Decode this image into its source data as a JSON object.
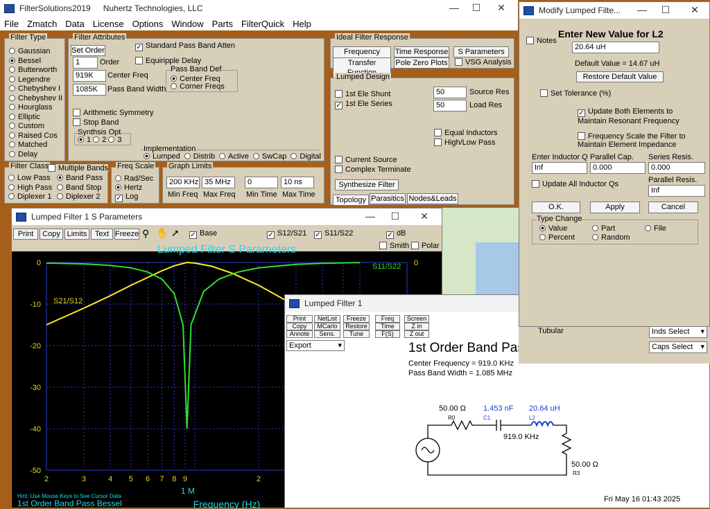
{
  "main": {
    "title": "FilterSolutions2019",
    "company": "Nuhertz Technologies, LLC",
    "menu": [
      "File",
      "Zmatch",
      "Data",
      "License",
      "Options",
      "Window",
      "Parts",
      "FilterQuick",
      "Help"
    ],
    "filter_type": {
      "label": "Filter Type",
      "items": [
        "Gaussian",
        "Bessel",
        "Butterworth",
        "Legendre",
        "Chebyshev I",
        "Chebyshev II",
        "Hourglass",
        "Elliptic",
        "Custom",
        "Raised Cos",
        "Matched",
        "Delay"
      ],
      "selected": "Bessel"
    },
    "attributes": {
      "label": "Filter Attributes",
      "set_order": "Set Order",
      "order": "1",
      "order_label": "Order",
      "center_freq": "919K",
      "center_label": "Center Freq",
      "bw": "1085K",
      "bw_label": "Pass Band Width",
      "std_atten": "Standard Pass Band Atten",
      "equiripple": "Equiripple Delay",
      "pbdef": "Pass Band  Def",
      "center_freqs": "Center Freq",
      "corner_freqs": "Corner Freqs",
      "arith": "Arithmetic Symmetry",
      "stopband": "Stop Band",
      "synth": "Synthsis Opt",
      "s1": "1",
      "s2": "2",
      "s3": "3",
      "impl": "Implementation",
      "impl_items": [
        "Lumped",
        "Distrib",
        "Active",
        "SwCap",
        "Digital"
      ]
    },
    "ideal": {
      "label": "Ideal Filter Response",
      "b1": "Frequency Resp.",
      "b2": "Time Response",
      "b3": "S Parameters",
      "b4": "Transfer Function",
      "b5": "Pole Zero Plots",
      "b6": "VSG Analysis"
    },
    "lumped": {
      "label": "Lumped Design",
      "shunt": "1st Ele Shunt",
      "series": "1st Ele Series",
      "src": "50",
      "src_label": "Source Res",
      "load": "50",
      "load_label": "Load Res",
      "equal": "Equal Inductors",
      "hilo": "High/Low Pass",
      "current": "Current Source",
      "complex": "Complex Terminate",
      "synth": "Synthesize Filter",
      "tabs": [
        "Topology",
        "Parasitics",
        "Nodes&Leads"
      ]
    },
    "fclass": {
      "label": "Filter Class",
      "multi": "Multiple Bands",
      "items": [
        "Low Pass",
        "Band Pass",
        "High Pass",
        "Band Stop",
        "Diplexer 1",
        "Diplexer 2"
      ]
    },
    "fscale": {
      "label": "Freq Scale",
      "items": [
        "Rad/Sec",
        "Hertz"
      ],
      "log": "Log"
    },
    "glimits": {
      "label": "Graph Limits",
      "v": [
        "200 KHz",
        "35 MHz",
        "0",
        "10 ns"
      ],
      "l": [
        "Min Freq",
        "Max Freq",
        "Min Time",
        "Max Time"
      ]
    }
  },
  "sp": {
    "title": "Lumped Filter 1 S Parameters",
    "toolbar": [
      "Print",
      "Copy",
      "Limits",
      "Text",
      "Freeze"
    ],
    "base": "Base",
    "s12": "S12/S21",
    "s11": "S11/S22",
    "db": "dB",
    "smith": "Smith",
    "polar": "Polar",
    "heading": "Lumped Filter S Parameters",
    "xlabel": "Frequency (Hz)",
    "hint": "Hint: Use Mouse Keys to See Cursor Data",
    "footer": "1st Order Band Pass Bessel",
    "lbl_s21": "S21/S12",
    "lbl_s11": "S11/S22",
    "m": "1 M",
    "right0": "0"
  },
  "chart_data": {
    "type": "line",
    "title": "Lumped Filter S Parameters",
    "xlabel": "Frequency (Hz)",
    "ylabel": "",
    "xscale": "log",
    "xlim": [
      200000,
      10000000
    ],
    "ylim": [
      -50,
      0
    ],
    "yticks": [
      "0",
      "-10",
      "-20",
      "-30",
      "-40",
      "-50"
    ],
    "xticks": [
      "2",
      "3",
      "4",
      "5",
      "6",
      "7",
      "8",
      "9",
      "1 M",
      "2",
      "3",
      "4",
      "5",
      "6"
    ],
    "series": [
      {
        "name": "S21/S12",
        "color": "#ffee22",
        "x": [
          200000,
          300000,
          400000,
          500000,
          600000,
          700000,
          800000,
          919000,
          1000000,
          1200000,
          1500000,
          2000000,
          3000000,
          4000000,
          5000000,
          6000000
        ],
        "y": [
          -15,
          -11,
          -8,
          -5.5,
          -3.6,
          -2,
          -0.8,
          0,
          -0.15,
          -0.9,
          -2.6,
          -5.5,
          -10.5,
          -14,
          -17,
          -19
        ]
      },
      {
        "name": "S11/S22",
        "color": "#30e030",
        "x": [
          200000,
          300000,
          400000,
          500000,
          600000,
          700000,
          800000,
          880000,
          919000,
          960000,
          1100000,
          1300000,
          1600000,
          2000000,
          3000000,
          4000000,
          5000000,
          6000000
        ],
        "y": [
          -0.14,
          -0.35,
          -0.7,
          -1.3,
          -2.3,
          -4,
          -7.5,
          -15,
          -40,
          -15,
          -7,
          -4,
          -2.3,
          -1.3,
          -0.45,
          -0.2,
          -0.1,
          -0.05
        ]
      }
    ]
  },
  "sch": {
    "title": "Lumped Filter 1",
    "btns": [
      [
        "Print",
        "NetList",
        "Freeze",
        "Freq",
        "Screen"
      ],
      [
        "Copy",
        "MCarlo",
        "Restore",
        "Time",
        "Z in"
      ],
      [
        "Annote",
        "Sens.",
        "Tune",
        "F(S)",
        "Z out"
      ]
    ],
    "export": "Export",
    "heading": "1st Order Band Pass Bessel",
    "cf": "Center Frequency = 919.0 KHz",
    "pbw": "Pass Band Width = 1.085 MHz",
    "r0": "50.00 Ω",
    "r0n": "R0",
    "c1": "1.453 nF",
    "c1n": "C1",
    "l2": "20.64 uH",
    "l2n": "L2",
    "f": "919.0 KHz",
    "r3": "50.00 Ω",
    "r3n": "R3",
    "date": "Fri May 16 01:43 2025"
  },
  "mod": {
    "title": "Modify Lumped Filte...",
    "notes": "Notes",
    "heading": "Enter New Value for L2",
    "value": "20.64 uH",
    "default": "Default Value = 14.67 uH",
    "restore": "Restore Default Value",
    "tol": "Set Tolerance (%)",
    "upd1": "Update Both Elements to",
    "upd2": "Maintain Resonant Frequency",
    "fs1": "Frequency Scale the Filter to",
    "fs2": "Maintain Element Impedance",
    "iq": "Enter Inductor Q",
    "pc": "Parallel Cap.",
    "sr": "Series Resis.",
    "iqv": "Inf",
    "pcv": "0.000",
    "srv": "0.000",
    "uaq": "Update All Inductor Qs",
    "pr": "Parallel Resis.",
    "prv": "Inf",
    "ok": "O.K.",
    "apply": "Apply",
    "cancel": "Cancel",
    "tc": "Type Change",
    "tc_items": [
      "Value",
      "Part",
      "File",
      "Percent",
      "Random"
    ],
    "tubular": "Tubular",
    "inds": "Inds Select",
    "caps": "Caps Select"
  }
}
